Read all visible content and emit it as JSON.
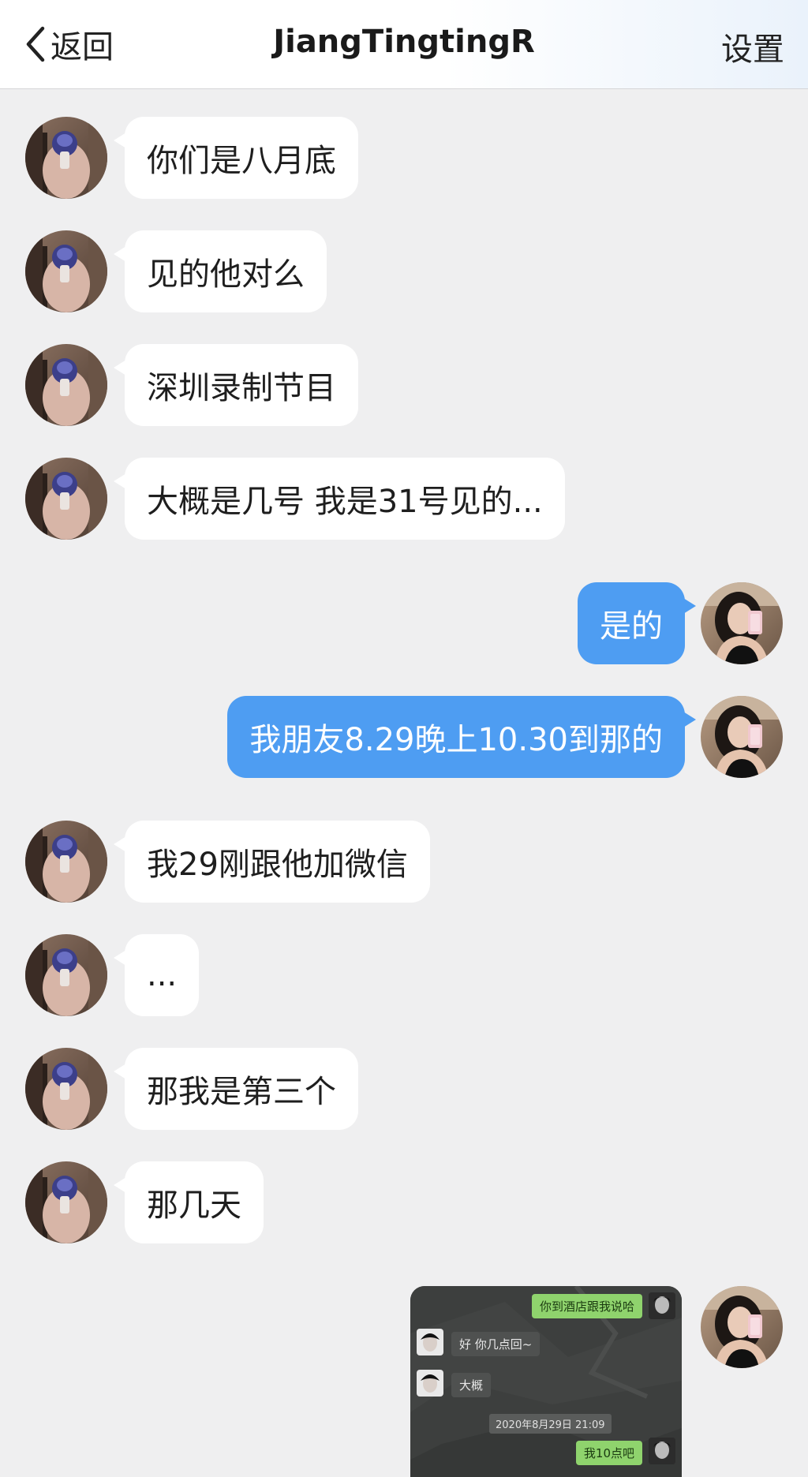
{
  "header": {
    "back_label": "返回",
    "title": "JiangTingtingR",
    "settings_label": "设置"
  },
  "colors": {
    "incoming_bubble": "#ffffff",
    "outgoing_bubble": "#4e9df2",
    "background": "#efeff0"
  },
  "messages": [
    {
      "from": "them",
      "text": "你们是八月底"
    },
    {
      "from": "them",
      "text": "见的他对么"
    },
    {
      "from": "them",
      "text": "深圳录制节目"
    },
    {
      "from": "them",
      "text": "大概是几号 我是31号见的..."
    },
    {
      "from": "me",
      "text": "是的"
    },
    {
      "from": "me",
      "text": "我朋友8.29晚上10.30到那的"
    },
    {
      "from": "them",
      "text": "我29刚跟他加微信"
    },
    {
      "from": "them",
      "text": "..."
    },
    {
      "from": "them",
      "text": "那我是第三个"
    },
    {
      "from": "them",
      "text": "那几天"
    }
  ],
  "screenshot_message": {
    "from": "me",
    "lines": [
      {
        "side": "right",
        "text": "你到酒店跟我说哈"
      },
      {
        "side": "left",
        "text": "好 你几点回~"
      },
      {
        "side": "left",
        "text": "大概"
      },
      {
        "side": "center",
        "text": "2020年8月29日 21:09"
      },
      {
        "side": "right",
        "text": "我10点吧"
      }
    ]
  }
}
